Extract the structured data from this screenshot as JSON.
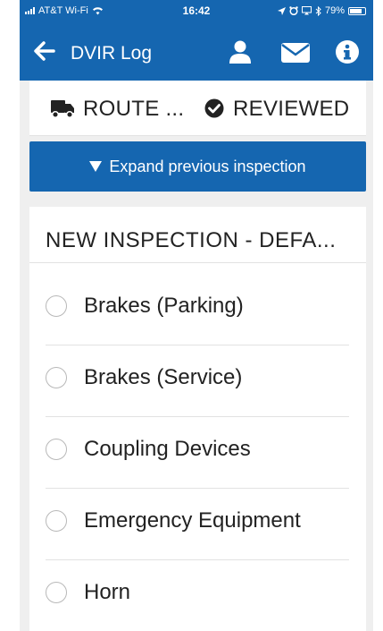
{
  "status_bar": {
    "carrier": "AT&T Wi-Fi",
    "time": "16:42",
    "battery": "79%",
    "battery_level": 0.79
  },
  "header": {
    "back_label": "DVIR Log",
    "icons": [
      "person-icon",
      "envelope-icon",
      "info-icon"
    ]
  },
  "route": {
    "route_label": "ROUTE ...",
    "status_label": "REVIEWED",
    "icons": [
      "truck-icon",
      "check-circle-icon"
    ]
  },
  "expand": {
    "label": "Expand previous inspection",
    "icon": "triangle-down-icon"
  },
  "inspection": {
    "title": "NEW INSPECTION - DEFA...",
    "items": [
      {
        "label": "Brakes (Parking)",
        "checked": false
      },
      {
        "label": "Brakes (Service)",
        "checked": false
      },
      {
        "label": "Coupling Devices",
        "checked": false
      },
      {
        "label": "Emergency Equipment",
        "checked": false
      },
      {
        "label": "Horn",
        "checked": false
      }
    ]
  },
  "colors": {
    "primary": "#1566b0",
    "background": "#efefef",
    "card": "#ffffff",
    "text": "#222222",
    "radio_border": "#b8b8b8"
  }
}
